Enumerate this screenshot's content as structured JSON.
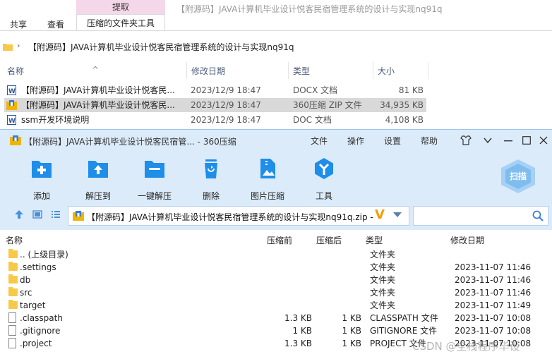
{
  "explorer": {
    "ribbon": {
      "context_group": "提取",
      "window_title": "【附源码】JAVA计算机毕业设计悦客民宿管理系统的设计与实现nq91q",
      "tabs": [
        "共享",
        "查看",
        "压缩的文件夹工具"
      ]
    },
    "address_path": "【附源码】JAVA计算机毕业设计悦客民宿管理系统的设计与实现nq91q",
    "columns": {
      "name": "名称",
      "date": "修改日期",
      "type": "类型",
      "size": "大小"
    },
    "files": [
      {
        "name": "【附源码】JAVA计算机毕业设计悦客民...",
        "date": "2023/12/9 18:47",
        "type": "DOCX 文档",
        "size": "81 KB",
        "icon": "word-doc-icon"
      },
      {
        "name": "【附源码】JAVA计算机毕业设计悦客民...",
        "date": "2023/12/9 18:47",
        "type": "360压缩 ZIP 文件",
        "size": "34,935 KB",
        "icon": "zip-archive-icon"
      },
      {
        "name": "ssm开发环境说明",
        "date": "2023/12/9 18:47",
        "type": "DOC 文档",
        "size": "4,108 KB",
        "icon": "word-doc-icon"
      }
    ]
  },
  "zip": {
    "title": "【附源码】JAVA计算机毕业设计悦客民宿管... - 360压缩",
    "menu": [
      "文件",
      "操作",
      "设置",
      "帮助"
    ],
    "toolbar": [
      {
        "label": "添加",
        "icon": "add-icon"
      },
      {
        "label": "解压到",
        "icon": "extract-to-icon"
      },
      {
        "label": "一键解压",
        "icon": "one-click-extract-icon"
      },
      {
        "label": "删除",
        "icon": "delete-icon"
      },
      {
        "label": "图片压缩",
        "icon": "image-compress-icon"
      },
      {
        "label": "工具",
        "icon": "tools-icon"
      }
    ],
    "scan_label": "扫描",
    "path": "【附源码】JAVA计算机毕业设计悦客民宿管理系统的设计与实现nq91q.zip -",
    "columns": {
      "name": "名称",
      "compressed": "压缩前",
      "after": "压缩后",
      "type": "类型",
      "date": "修改日期"
    },
    "rows": [
      {
        "name": ".. (上级目录)",
        "comp": "",
        "orig": "",
        "type": "文件夹",
        "date": "",
        "kind": "folder"
      },
      {
        "name": ".settings",
        "comp": "",
        "orig": "",
        "type": "文件夹",
        "date": "2023-11-07 11:46",
        "kind": "folder"
      },
      {
        "name": "db",
        "comp": "",
        "orig": "",
        "type": "文件夹",
        "date": "2023-11-07 11:46",
        "kind": "folder"
      },
      {
        "name": "src",
        "comp": "",
        "orig": "",
        "type": "文件夹",
        "date": "2023-11-07 11:46",
        "kind": "folder"
      },
      {
        "name": "target",
        "comp": "",
        "orig": "",
        "type": "文件夹",
        "date": "2023-11-07 11:49",
        "kind": "folder"
      },
      {
        "name": ".classpath",
        "comp": "1.3 KB",
        "orig": "1 KB",
        "type": "CLASSPATH 文件",
        "date": "2023-11-07 10:08",
        "kind": "file"
      },
      {
        "name": ".gitignore",
        "comp": "1 KB",
        "orig": "1 KB",
        "type": "GITIGNORE 文件",
        "date": "2023-11-07 10:08",
        "kind": "file"
      },
      {
        "name": ".project",
        "comp": "1.3 KB",
        "orig": "1 KB",
        "type": "PROJECT 文件",
        "date": "2023-11-07 10:08",
        "kind": "file"
      }
    ]
  },
  "watermark": "CSDN @全栈程序毕设",
  "colors": {
    "zip_panel": "#dcebfa",
    "tool_blue": "#1e8ee8",
    "selected_row": "#d9d9d9",
    "context_pink": "#f5d7ea"
  }
}
